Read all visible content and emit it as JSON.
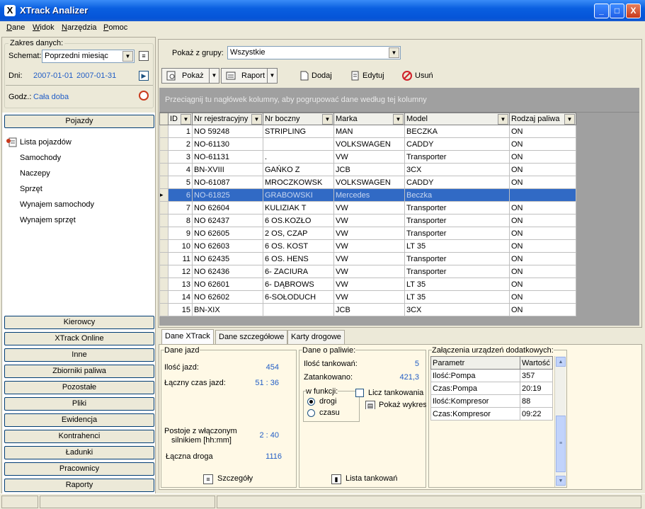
{
  "app": {
    "title": "XTrack Analizer",
    "icon_letter": "X"
  },
  "window_buttons": {
    "minimize": "_",
    "maximize": "□",
    "close": "X"
  },
  "menu": [
    "Dane",
    "Widok",
    "Narzędzia",
    "Pomoc"
  ],
  "zakres": {
    "legend": "Zakres danych:",
    "schemat_label": "Schemat:",
    "schemat_value": "Poprzedni miesiąc",
    "dni_label": "Dni:",
    "date_from": "2007-01-01",
    "date_to": "2007-01-31",
    "godz_label": "Godz.:",
    "godz_value": "Cała doba"
  },
  "nav": {
    "pojazdy": "Pojazdy",
    "items": [
      "Lista pojazdów",
      "Samochody",
      "Naczepy",
      "Sprzęt",
      "Wynajem samochody",
      "Wynajem sprzęt"
    ],
    "groups": [
      "Kierowcy",
      "XTrack Online",
      "Inne",
      "Zbiorniki paliwa",
      "Pozostałe",
      "Pliki",
      "Ewidencja",
      "Kontrahenci",
      "Ładunki",
      "Pracownicy",
      "Raporty"
    ]
  },
  "filter": {
    "label": "Pokaż z grupy:",
    "value": "Wszystkie"
  },
  "toolbar": {
    "pokaz": "Pokaż",
    "raport": "Raport",
    "dodaj": "Dodaj",
    "edytuj": "Edytuj",
    "usun": "Usuń"
  },
  "group_hint": "Przeciągnij tu nagłówek kolumny, aby pogrupować dane według tej kolumny",
  "columns": [
    "ID",
    "Nr rejestracyjny",
    "Nr boczny",
    "Marka",
    "Model",
    "Rodzaj paliwa"
  ],
  "rows": [
    [
      "1",
      "NO 59248",
      "STRIPLING",
      "MAN",
      "BECZKA",
      "ON"
    ],
    [
      "2",
      "NO-61130",
      "",
      "VOLKSWAGEN",
      "CADDY",
      "ON"
    ],
    [
      "3",
      "NO-61131",
      ".",
      "VW",
      "Transporter",
      "ON"
    ],
    [
      "4",
      "BN-XVIII",
      "GAŃKO Z",
      "JCB",
      "3CX",
      "ON"
    ],
    [
      "5",
      "NO-61087",
      "MROCZKOWSK",
      "VOLKSWAGEN",
      "CADDY",
      "ON"
    ],
    [
      "6",
      "NO-61825",
      "GRABOWSKI",
      "Mercedes",
      "Beczka",
      ""
    ],
    [
      "7",
      "NO 62604",
      "KULIZIAK T",
      "VW",
      "Transporter",
      "ON"
    ],
    [
      "8",
      "NO 62437",
      "6 OS.KOZŁO",
      "VW",
      "Transporter",
      "ON"
    ],
    [
      "9",
      "NO 62605",
      "2 OS, CZAP",
      "VW",
      "Transporter",
      "ON"
    ],
    [
      "10",
      "NO 62603",
      "6 OS. KOST",
      "VW",
      "LT 35",
      "ON"
    ],
    [
      "11",
      "NO 62435",
      "6 OS. HENS",
      "VW",
      "Transporter",
      "ON"
    ],
    [
      "12",
      "NO 62436",
      "6- ZACIURA",
      "VW",
      "Transporter",
      "ON"
    ],
    [
      "13",
      "NO 62601",
      "6- DĄBROWS",
      "VW",
      "LT 35",
      "ON"
    ],
    [
      "14",
      "NO 62602",
      "6-SOŁODUCH",
      "VW",
      "LT 35",
      "ON"
    ],
    [
      "15",
      "BN-XIX",
      "",
      "JCB",
      "3CX",
      "ON"
    ]
  ],
  "selected_row": 6,
  "tabs": [
    "Dane XTrack",
    "Dane szczegółowe",
    "Karty drogowe"
  ],
  "jazdy": {
    "legend": "Dane jazd",
    "ilosc_label": "Ilość jazd:",
    "ilosc": "454",
    "czas_label": "Łączny czas jazd:",
    "czas": "51 : 36",
    "postoje_label1": "Postoje z włączonym",
    "postoje_label2": "silnikiem [hh:mm]",
    "postoje": "2 : 40",
    "droga_label": "Łączna droga",
    "droga": "1116",
    "szczegoly": "Szczegóły"
  },
  "paliwo": {
    "legend": "Dane o paliwie:",
    "tank_label": "Ilość tankowań:",
    "tank": "5",
    "zat_label": "Zatankowano:",
    "zat": "421,3",
    "wfunkcji": "w funkcji:",
    "drogi": "drogi",
    "czasu": "czasu",
    "licz": "Licz tankowania",
    "wykres": "Pokaż wykres",
    "lista": "Lista tankowań"
  },
  "zalaczenia": {
    "legend": "Załączenia urządzeń dodatkowych:",
    "headers": [
      "Parametr",
      "Wartość"
    ],
    "rows": [
      [
        "Ilość:Pompa",
        "357"
      ],
      [
        "Czas:Pompa",
        "20:19"
      ],
      [
        "Ilość:Kompresor",
        "88"
      ],
      [
        "Czas:Kompresor",
        "09:22"
      ]
    ]
  }
}
